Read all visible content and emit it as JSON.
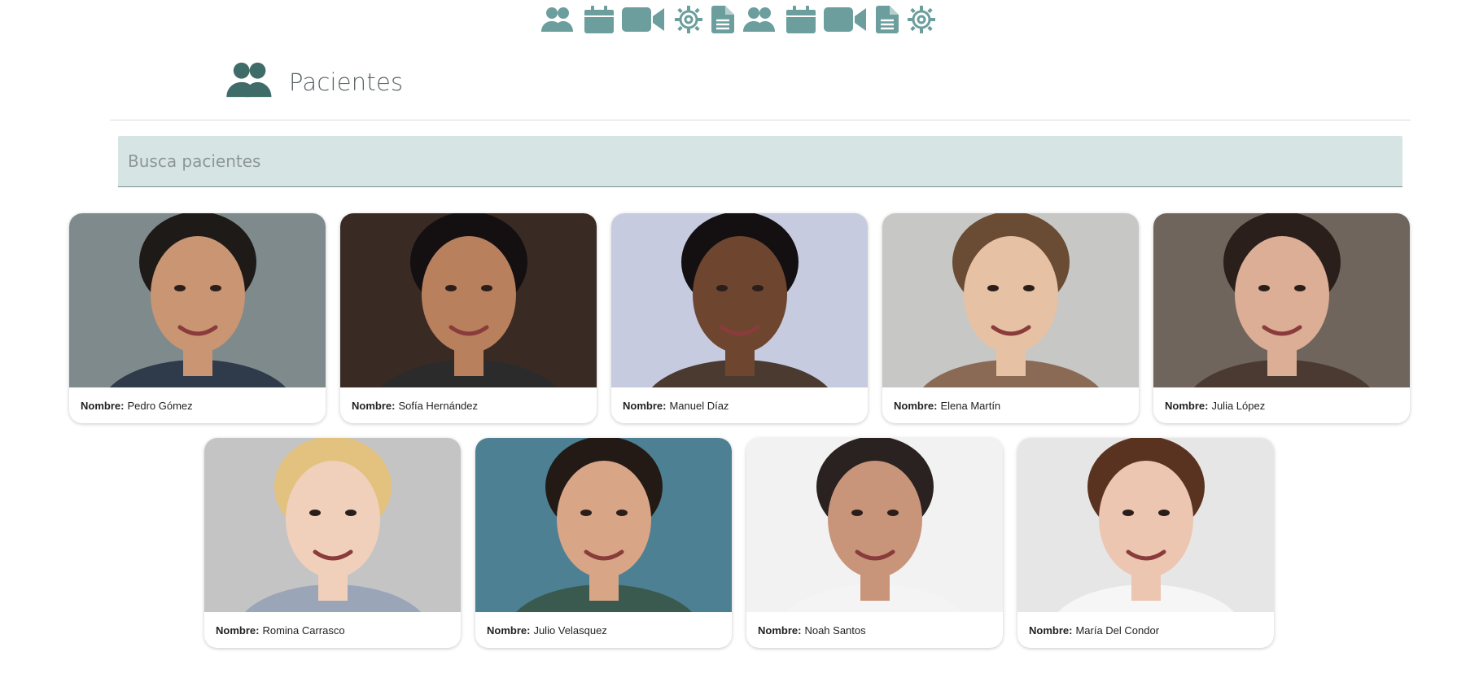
{
  "nav": {
    "color": "#6b9e9c",
    "icons": [
      "users-icon",
      "calendar-icon",
      "video-icon",
      "settings-icon",
      "document-icon",
      "users-icon",
      "calendar-icon",
      "video-icon",
      "document-icon",
      "settings-icon"
    ]
  },
  "header": {
    "title": "Pacientes",
    "icon": "users-icon",
    "icon_color": "#3f6b69"
  },
  "search": {
    "placeholder": "Busca pacientes",
    "value": ""
  },
  "patients": {
    "label": "Nombre:",
    "items": [
      {
        "name": "Pedro Gómez",
        "bg": "#7f8a8c",
        "skin": "#c99573",
        "hair": "#1e1a18",
        "shirt": "#2f3a4a"
      },
      {
        "name": "Sofía Hernández",
        "bg": "#3a2a24",
        "skin": "#b9805d",
        "hair": "#141012",
        "shirt": "#2b2b2b"
      },
      {
        "name": "Manuel Díaz",
        "bg": "#c6cbe0",
        "skin": "#6e4630",
        "hair": "#141012",
        "shirt": "#4a3a30"
      },
      {
        "name": "Elena Martín",
        "bg": "#c7c7c5",
        "skin": "#e7c1a4",
        "hair": "#6a4b33",
        "shirt": "#8a6a55"
      },
      {
        "name": "Julia López",
        "bg": "#6f655c",
        "skin": "#dcae96",
        "hair": "#2a1f1a",
        "shirt": "#4a3a32"
      },
      {
        "name": "Romina Carrasco",
        "bg": "#c4c4c4",
        "skin": "#f0d0bb",
        "hair": "#e2c27e",
        "shirt": "#9aa6b8"
      },
      {
        "name": "Julio Velasquez",
        "bg": "#4d8093",
        "skin": "#d8a587",
        "hair": "#231a16",
        "shirt": "#3a5a50"
      },
      {
        "name": "Noah Santos",
        "bg": "#f2f2f2",
        "skin": "#c9957a",
        "hair": "#2a2220",
        "shirt": "#f4f4f4"
      },
      {
        "name": "María Del Condor",
        "bg": "#e6e6e6",
        "skin": "#ecc6b0",
        "hair": "#5a3320",
        "shirt": "#f6f6f6"
      }
    ]
  }
}
